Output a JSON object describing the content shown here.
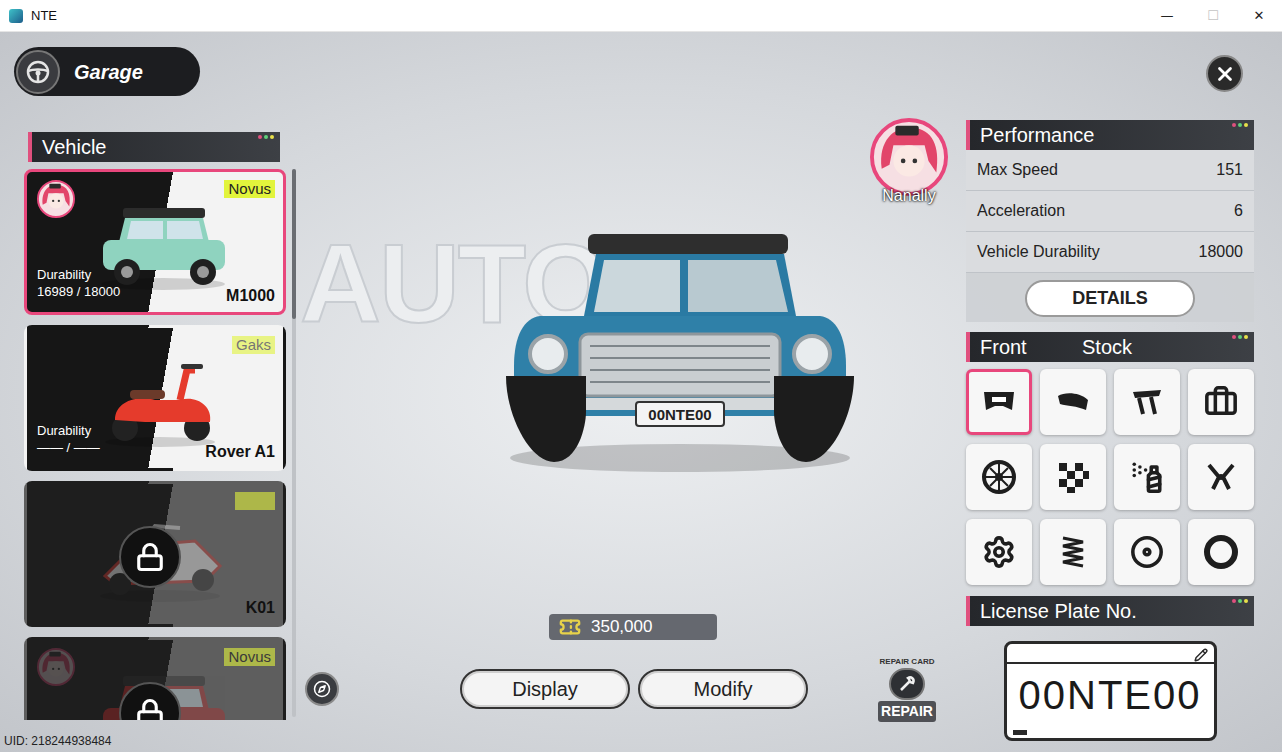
{
  "window": {
    "title": "NTE",
    "controls": [
      {
        "glyph": "—",
        "disabled": false
      },
      {
        "glyph": "☐",
        "disabled": true
      },
      {
        "glyph": "✕",
        "disabled": false
      }
    ]
  },
  "header": {
    "title": "Garage"
  },
  "backdrop_text": "AUTONO",
  "vehicle_panel": {
    "title": "Vehicle",
    "vehicles": [
      {
        "name": "M1000",
        "tag": "Novus",
        "durability_label": "Durability",
        "durability": "16989 / 18000",
        "locked": false,
        "selected": true,
        "owner": true,
        "kind": "car",
        "color": "#8fd3bf"
      },
      {
        "name": "Rover A1",
        "tag": "Gaks",
        "durability_label": "Durability",
        "durability": "—— / ——",
        "locked": false,
        "selected": false,
        "owner": false,
        "kind": "scooter",
        "color": "#e53b2c"
      },
      {
        "name": "K01",
        "tag": "",
        "durability_label": "",
        "durability": "",
        "locked": true,
        "selected": false,
        "owner": false,
        "kind": "kart",
        "color": "#c8352f"
      },
      {
        "name": "",
        "tag": "Novus",
        "durability_label": "",
        "durability": "",
        "locked": true,
        "selected": false,
        "owner": true,
        "kind": "car",
        "color": "#b52a2a"
      }
    ]
  },
  "character": {
    "name": "Nanally"
  },
  "currency": {
    "amount": "350,000"
  },
  "buttons": [
    {
      "label": "Display"
    },
    {
      "label": "Modify"
    }
  ],
  "repair": {
    "arc": "REPAIR CARD",
    "label": "REPAIR"
  },
  "performance": {
    "title": "Performance",
    "stats": [
      {
        "label": "Max Speed",
        "value": "151"
      },
      {
        "label": "Acceleration",
        "value": "6"
      },
      {
        "label": "Vehicle Durability",
        "value": "18000"
      }
    ],
    "details": "DETAILS"
  },
  "parts": {
    "slot": "Front",
    "status": "Stock",
    "tiles": [
      {
        "kind": "front",
        "selected": true
      },
      {
        "kind": "rear",
        "selected": false
      },
      {
        "kind": "spoiler",
        "selected": false
      },
      {
        "kind": "case",
        "selected": false
      },
      {
        "kind": "wheel",
        "selected": false
      },
      {
        "kind": "livery",
        "selected": false
      },
      {
        "kind": "paint",
        "selected": false
      },
      {
        "kind": "engine",
        "selected": false
      },
      {
        "kind": "gearbox",
        "selected": false
      },
      {
        "kind": "suspension",
        "selected": false
      },
      {
        "kind": "brake",
        "selected": false
      },
      {
        "kind": "tire",
        "selected": false
      }
    ]
  },
  "license_plate": {
    "title": "License Plate No.",
    "number": "00NTE00"
  },
  "uid": "UID: 218244938484"
}
